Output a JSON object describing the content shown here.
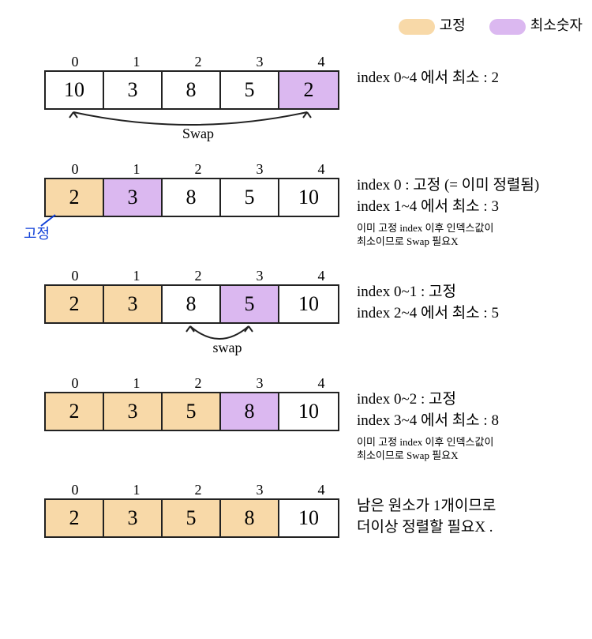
{
  "colors": {
    "fixed": "#f8d9a8",
    "min": "#dbb8f0"
  },
  "legend": {
    "fixed_label": "고정",
    "min_label": "최소숫자"
  },
  "index_labels": [
    "0",
    "1",
    "2",
    "3",
    "4"
  ],
  "steps": [
    {
      "cells": [
        {
          "v": "10",
          "state": "none"
        },
        {
          "v": "3",
          "state": "none"
        },
        {
          "v": "8",
          "state": "none"
        },
        {
          "v": "5",
          "state": "none"
        },
        {
          "v": "2",
          "state": "min"
        }
      ],
      "notes": {
        "line1": "index 0~4 에서 최소 : 2"
      },
      "swap": "Swap",
      "swap_between": [
        0,
        4
      ]
    },
    {
      "cells": [
        {
          "v": "2",
          "state": "fixed"
        },
        {
          "v": "3",
          "state": "min"
        },
        {
          "v": "8",
          "state": "none"
        },
        {
          "v": "5",
          "state": "none"
        },
        {
          "v": "10",
          "state": "none"
        }
      ],
      "notes": {
        "line1": "index 0 : 고정 (= 이미 정렬됨)",
        "line2": "index 1~4 에서 최소 : 3",
        "sub1": "이미 고정 index 이후 인덱스값이",
        "sub2": "최소이므로 Swap 필요X"
      },
      "fixed_callout": "고정"
    },
    {
      "cells": [
        {
          "v": "2",
          "state": "fixed"
        },
        {
          "v": "3",
          "state": "fixed"
        },
        {
          "v": "8",
          "state": "none"
        },
        {
          "v": "5",
          "state": "min"
        },
        {
          "v": "10",
          "state": "none"
        }
      ],
      "notes": {
        "line1": "index 0~1 : 고정",
        "line2": "index 2~4 에서 최소 : 5"
      },
      "swap": "swap",
      "swap_between": [
        2,
        3
      ]
    },
    {
      "cells": [
        {
          "v": "2",
          "state": "fixed"
        },
        {
          "v": "3",
          "state": "fixed"
        },
        {
          "v": "5",
          "state": "fixed"
        },
        {
          "v": "8",
          "state": "min"
        },
        {
          "v": "10",
          "state": "none"
        }
      ],
      "notes": {
        "line1": "index 0~2 : 고정",
        "line2": "index 3~4 에서 최소 : 8",
        "sub1": "이미 고정 index 이후 인덱스값이",
        "sub2": "최소이므로 Swap 필요X"
      }
    },
    {
      "cells": [
        {
          "v": "2",
          "state": "fixed"
        },
        {
          "v": "3",
          "state": "fixed"
        },
        {
          "v": "5",
          "state": "fixed"
        },
        {
          "v": "8",
          "state": "fixed"
        },
        {
          "v": "10",
          "state": "none"
        }
      ],
      "notes": {
        "line1": "남은 원소가 1개이므로",
        "line2": "더이상 정렬할 필요X ."
      }
    }
  ]
}
